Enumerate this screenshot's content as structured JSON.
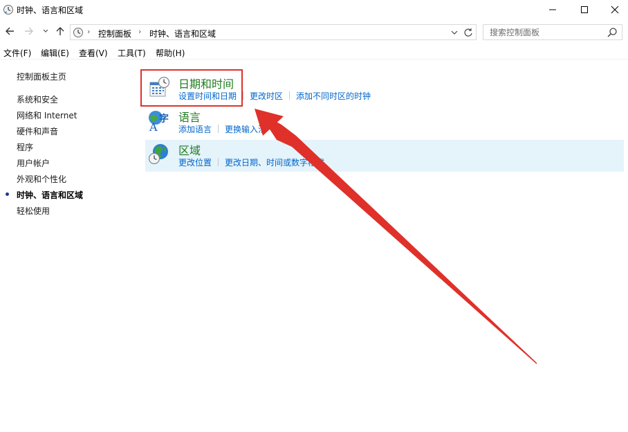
{
  "window": {
    "title": "时钟、语言和区域",
    "minimize_glyph": "—",
    "maximize_glyph": "☐",
    "close_glyph": "✕"
  },
  "address": {
    "crumbs": [
      "控制面板",
      "时钟、语言和区域"
    ],
    "separator": "›",
    "search_placeholder": "搜索控制面板"
  },
  "menu": [
    "文件(F)",
    "编辑(E)",
    "查看(V)",
    "工具(T)",
    "帮助(H)"
  ],
  "sidebar": {
    "home": "控制面板主页",
    "items": [
      "系统和安全",
      "网络和 Internet",
      "硬件和声音",
      "程序",
      "用户帐户",
      "外观和个性化",
      "时钟、语言和区域",
      "轻松使用"
    ],
    "current_index": 6
  },
  "categories": [
    {
      "title": "日期和时间",
      "links": [
        "设置时间和日期",
        "更改时区",
        "添加不同时区的时钟"
      ],
      "icon": "calendar-clock-icon"
    },
    {
      "title": "语言",
      "links": [
        "添加语言",
        "更换输入法"
      ],
      "icon": "language-icon"
    },
    {
      "title": "区域",
      "links": [
        "更改位置",
        "更改日期、时间或数字格式"
      ],
      "icon": "globe-clock-icon"
    }
  ],
  "colors": {
    "link": "#0066cc",
    "category_title": "#1e7b1e",
    "annotation": "#e0302a",
    "hover_row": "#e5f3fb"
  }
}
